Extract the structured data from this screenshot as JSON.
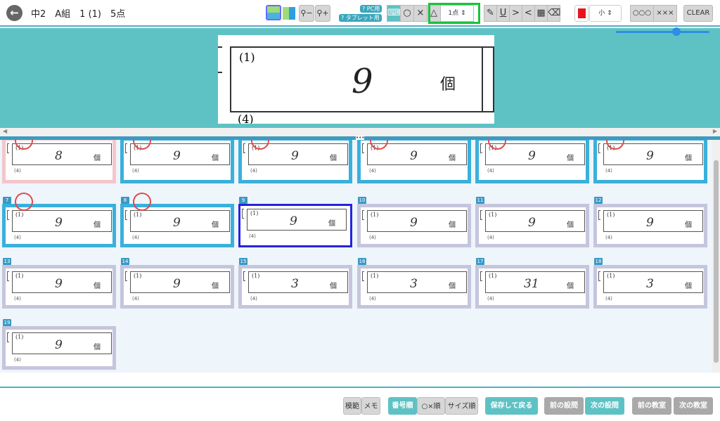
{
  "header": {
    "title": "中2　A組　1 (1)　5点",
    "pc_label": "PC用",
    "tablet_label": "タブレット用",
    "score_select": "1点",
    "size_select": "小",
    "circle_all": "○○○",
    "cross_all": "×××",
    "clear_label": "CLEAR",
    "marks": {
      "circle": "○",
      "cross": "×",
      "triangle": "△"
    }
  },
  "preview": {
    "question_label": "(1)",
    "answer": "9",
    "unit": "個",
    "next_label": "(4)"
  },
  "grid": {
    "question_label": "(1)",
    "unit": "個",
    "next_label": "(4)",
    "cells": [
      {
        "num": "",
        "answer": "8",
        "status": "pink",
        "mark": true
      },
      {
        "num": "",
        "answer": "9",
        "status": "graded",
        "mark": true
      },
      {
        "num": "",
        "answer": "9",
        "status": "graded",
        "mark": true
      },
      {
        "num": "",
        "answer": "9",
        "status": "graded",
        "mark": true
      },
      {
        "num": "",
        "answer": "9",
        "status": "graded",
        "mark": true
      },
      {
        "num": "",
        "answer": "9",
        "status": "graded",
        "mark": true
      },
      {
        "num": "7",
        "answer": "9",
        "status": "graded",
        "mark": true
      },
      {
        "num": "8",
        "answer": "9",
        "status": "graded",
        "mark": true
      },
      {
        "num": "9",
        "answer": "9",
        "status": "active",
        "mark": false
      },
      {
        "num": "10",
        "answer": "9",
        "status": "pending",
        "mark": false
      },
      {
        "num": "11",
        "answer": "9",
        "status": "pending",
        "mark": false
      },
      {
        "num": "12",
        "answer": "9",
        "status": "pending",
        "mark": false
      },
      {
        "num": "13",
        "answer": "9",
        "status": "pending",
        "mark": false
      },
      {
        "num": "14",
        "answer": "9",
        "status": "pending",
        "mark": false
      },
      {
        "num": "15",
        "answer": "3",
        "status": "pending",
        "mark": false
      },
      {
        "num": "16",
        "answer": "3",
        "status": "pending",
        "mark": false
      },
      {
        "num": "17",
        "answer": "31",
        "status": "pending",
        "mark": false
      },
      {
        "num": "18",
        "answer": "3",
        "status": "pending",
        "mark": false
      },
      {
        "num": "19",
        "answer": "9",
        "status": "pending",
        "mark": false
      }
    ]
  },
  "footer": {
    "model_answer": "模範",
    "memo": "メモ",
    "sort_number": "番号順",
    "sort_mark": "○×順",
    "sort_size": "サイズ順",
    "save_return": "保存して戻る",
    "prev_question": "前の設問",
    "next_question": "次の設問",
    "prev_class": "前の教室",
    "next_class": "次の教室"
  },
  "colors": {
    "accent": "#5ec2c5",
    "graded_border": "#3ab0dc",
    "pending_border": "#c5c5dd",
    "pink_border": "#f4c6cc",
    "active_border": "#2424e0",
    "highlight": "#17c43a",
    "red": "#e8141c"
  }
}
